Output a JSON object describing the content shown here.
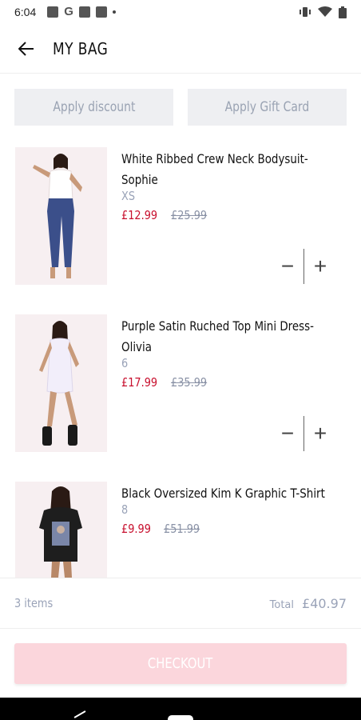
{
  "status_bar": {
    "time": "6:04",
    "g_label": "G"
  },
  "header": {
    "title": "MY BAG"
  },
  "promo": {
    "discount_label": "Apply discount",
    "gift_card_label": "Apply Gift Card"
  },
  "items": [
    {
      "name_line1": "White Ribbed Crew Neck Bodysuit-",
      "name_line2": "Sophie",
      "size": "XS",
      "price": "£12.99",
      "was_price": "£25.99"
    },
    {
      "name_line1": "Purple Satin Ruched Top Mini Dress-",
      "name_line2": "Olivia",
      "size": "6",
      "price": "£17.99",
      "was_price": "£35.99"
    },
    {
      "name_line1": "Black Oversized Kim K Graphic T-Shirt",
      "name_line2": "",
      "size": "8",
      "price": "£9.99",
      "was_price": "£51.99"
    }
  ],
  "qty_controls": {
    "minus": "−",
    "plus": "+"
  },
  "summary": {
    "items_count": "3 items",
    "total_label": "Total",
    "total_value": "£40.97"
  },
  "checkout": {
    "label": "CHECKOUT"
  },
  "colors": {
    "sale_red": "#c8102e",
    "checkout_pink": "#fbd6dc",
    "muted": "#9aa3b8"
  }
}
